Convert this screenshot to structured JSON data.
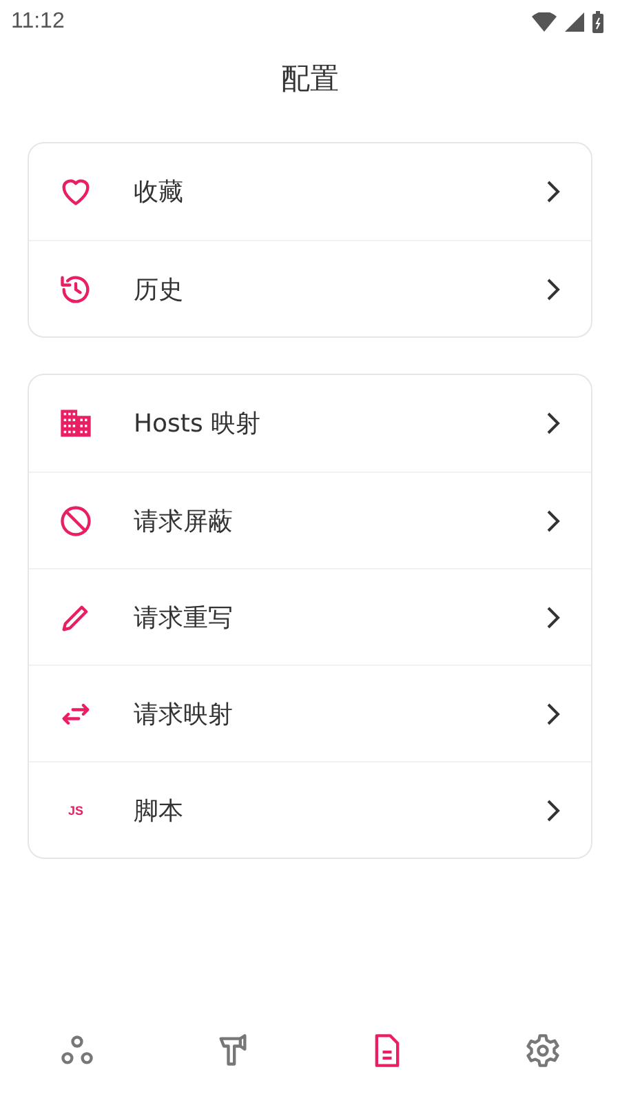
{
  "status_bar": {
    "time": "11:12"
  },
  "title": "配置",
  "groups": [
    {
      "items": [
        {
          "kind": "heart",
          "label": "收藏"
        },
        {
          "kind": "history",
          "label": "历史"
        }
      ]
    },
    {
      "items": [
        {
          "kind": "building",
          "label": "Hosts 映射"
        },
        {
          "kind": "block",
          "label": "请求屏蔽"
        },
        {
          "kind": "pencil",
          "label": "请求重写"
        },
        {
          "kind": "swap",
          "label": "请求映射"
        },
        {
          "kind": "js",
          "icon_text": "JS",
          "label": "脚本"
        }
      ]
    }
  ],
  "nav": [
    {
      "kind": "circles",
      "selected": false
    },
    {
      "kind": "hammer",
      "selected": false
    },
    {
      "kind": "document",
      "selected": true
    },
    {
      "kind": "gear",
      "selected": false
    }
  ]
}
